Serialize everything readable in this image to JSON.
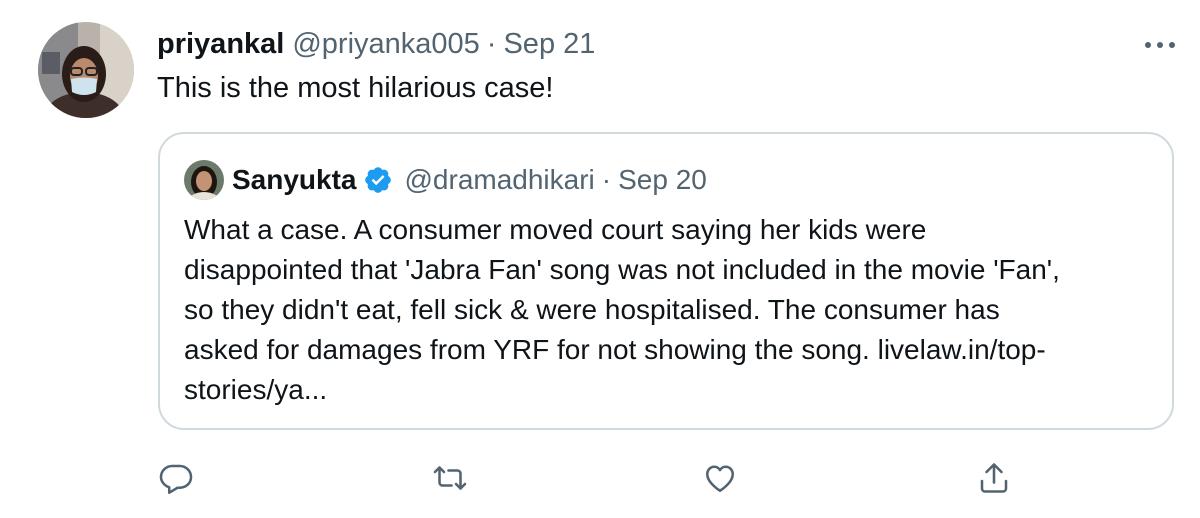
{
  "tweet": {
    "display_name": "priyankal",
    "handle": "@priyanka005",
    "separator": "·",
    "timestamp": "Sep 21",
    "text": "This is the most hilarious case!",
    "more_icon": "more-horizontal-icon"
  },
  "quoted_tweet": {
    "display_name": "Sanyukta",
    "verified": true,
    "verified_icon": "verified-badge-icon",
    "handle": "@dramadhikari",
    "separator": "·",
    "timestamp": "Sep 20",
    "text_lines": [
      "What a case. A consumer moved court saying her kids were",
      "disappointed that 'Jabra Fan' song was not included in the movie 'Fan',",
      "so they didn't eat, fell sick & were hospitalised. The consumer has",
      "asked for damages from YRF for not showing the song.  livelaw.in/top-",
      "stories/ya..."
    ]
  },
  "actions": [
    {
      "name": "reply",
      "icon": "reply-icon"
    },
    {
      "name": "retweet",
      "icon": "retweet-icon"
    },
    {
      "name": "like",
      "icon": "heart-icon"
    },
    {
      "name": "share",
      "icon": "share-icon"
    }
  ],
  "colors": {
    "text_primary": "#0f1419",
    "text_secondary": "#536471",
    "border": "#cfd9de",
    "verified_blue": "#1d9bf0"
  }
}
